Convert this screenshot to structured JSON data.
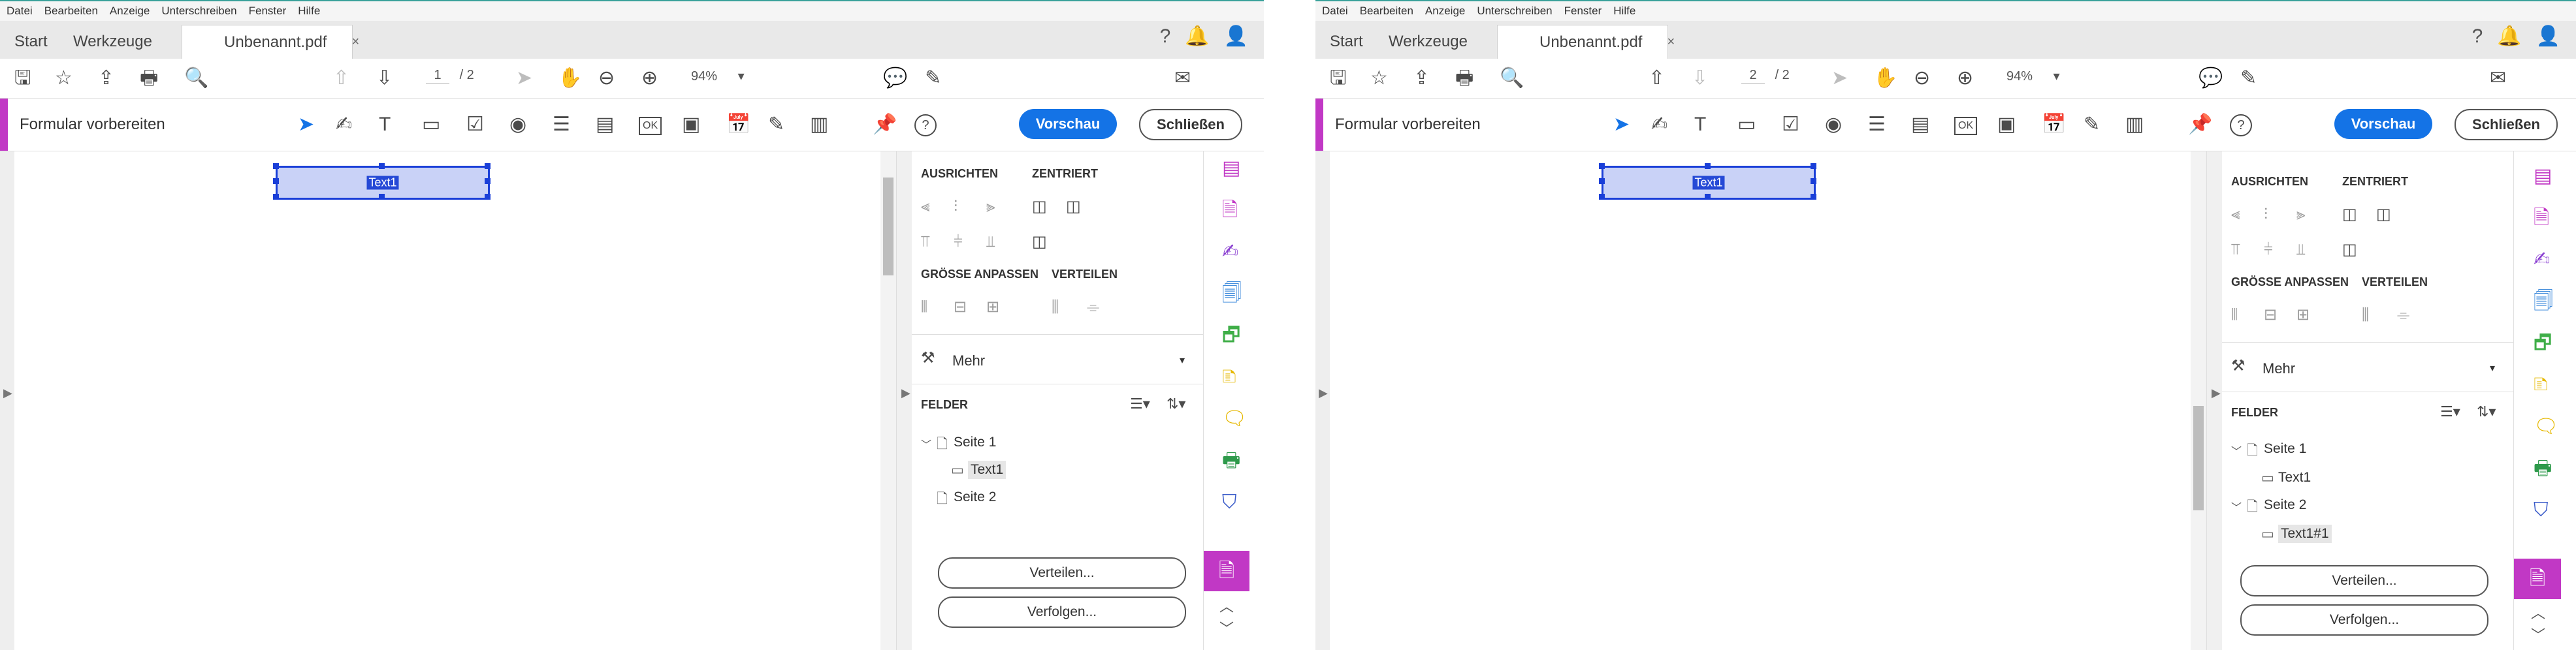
{
  "menu": [
    "Datei",
    "Bearbeiten",
    "Anzeige",
    "Unterschreiben",
    "Fenster",
    "Hilfe"
  ],
  "tabs": {
    "start": "Start",
    "tools": "Werkzeuge",
    "document": "Unbenannt.pdf",
    "close_glyph": "×"
  },
  "header_icons": {
    "help": "?",
    "bell": "🔔",
    "avatar": "👤"
  },
  "toolbar": {
    "save": "🖫",
    "star": "☆",
    "upload": "⇪",
    "print": "🖶",
    "search": "🔍",
    "page_up": "⇧",
    "page_down": "⇩",
    "page_separator": "/ 2",
    "zoom": "94%",
    "zoom_caret": "▾",
    "zoom_out": "⊖",
    "zoom_in": "⊕",
    "select": "➤",
    "hand": "✋",
    "comment": "💬",
    "pen": "✎",
    "mail": "✉"
  },
  "formbar": {
    "title": "Formular vorbereiten",
    "tools": [
      "➤",
      "✍",
      "T",
      "▭",
      "☑",
      "◉",
      "☰",
      "▤",
      "OK",
      "▣",
      "📅",
      "✎",
      "▥",
      "📌",
      "?"
    ],
    "preview_label": "Vorschau",
    "close_label": "Schließen"
  },
  "panel": {
    "align_heading": "AUSRICHTEN",
    "center_heading": "ZENTRIERT",
    "size_heading": "GRÖSSE ANPASSEN",
    "distribute_heading": "VERTEILEN",
    "more_label": "Mehr",
    "more_caret": "▾",
    "fields_heading": "FELDER",
    "distribute_button": "Verteilen...",
    "track_button": "Verfolgen..."
  },
  "views": [
    {
      "page_number": "1",
      "field_label": "Text1",
      "tree": [
        {
          "label": "Seite 1",
          "caret": "﹀"
        },
        {
          "label": "Text1"
        },
        {
          "label": "Seite 2"
        }
      ]
    },
    {
      "page_number": "2",
      "field_label": "Text1",
      "tree": [
        {
          "label": "Seite 1",
          "caret": "﹀"
        },
        {
          "label": "Text1"
        },
        {
          "label": "Seite 2",
          "caret": "﹀"
        },
        {
          "label": "Text1#1"
        }
      ]
    }
  ],
  "colors": {
    "accent": "#c138c5",
    "blue": "#1473e6",
    "field_border": "#1a3fd8",
    "teal_line": "#3aa19a"
  }
}
